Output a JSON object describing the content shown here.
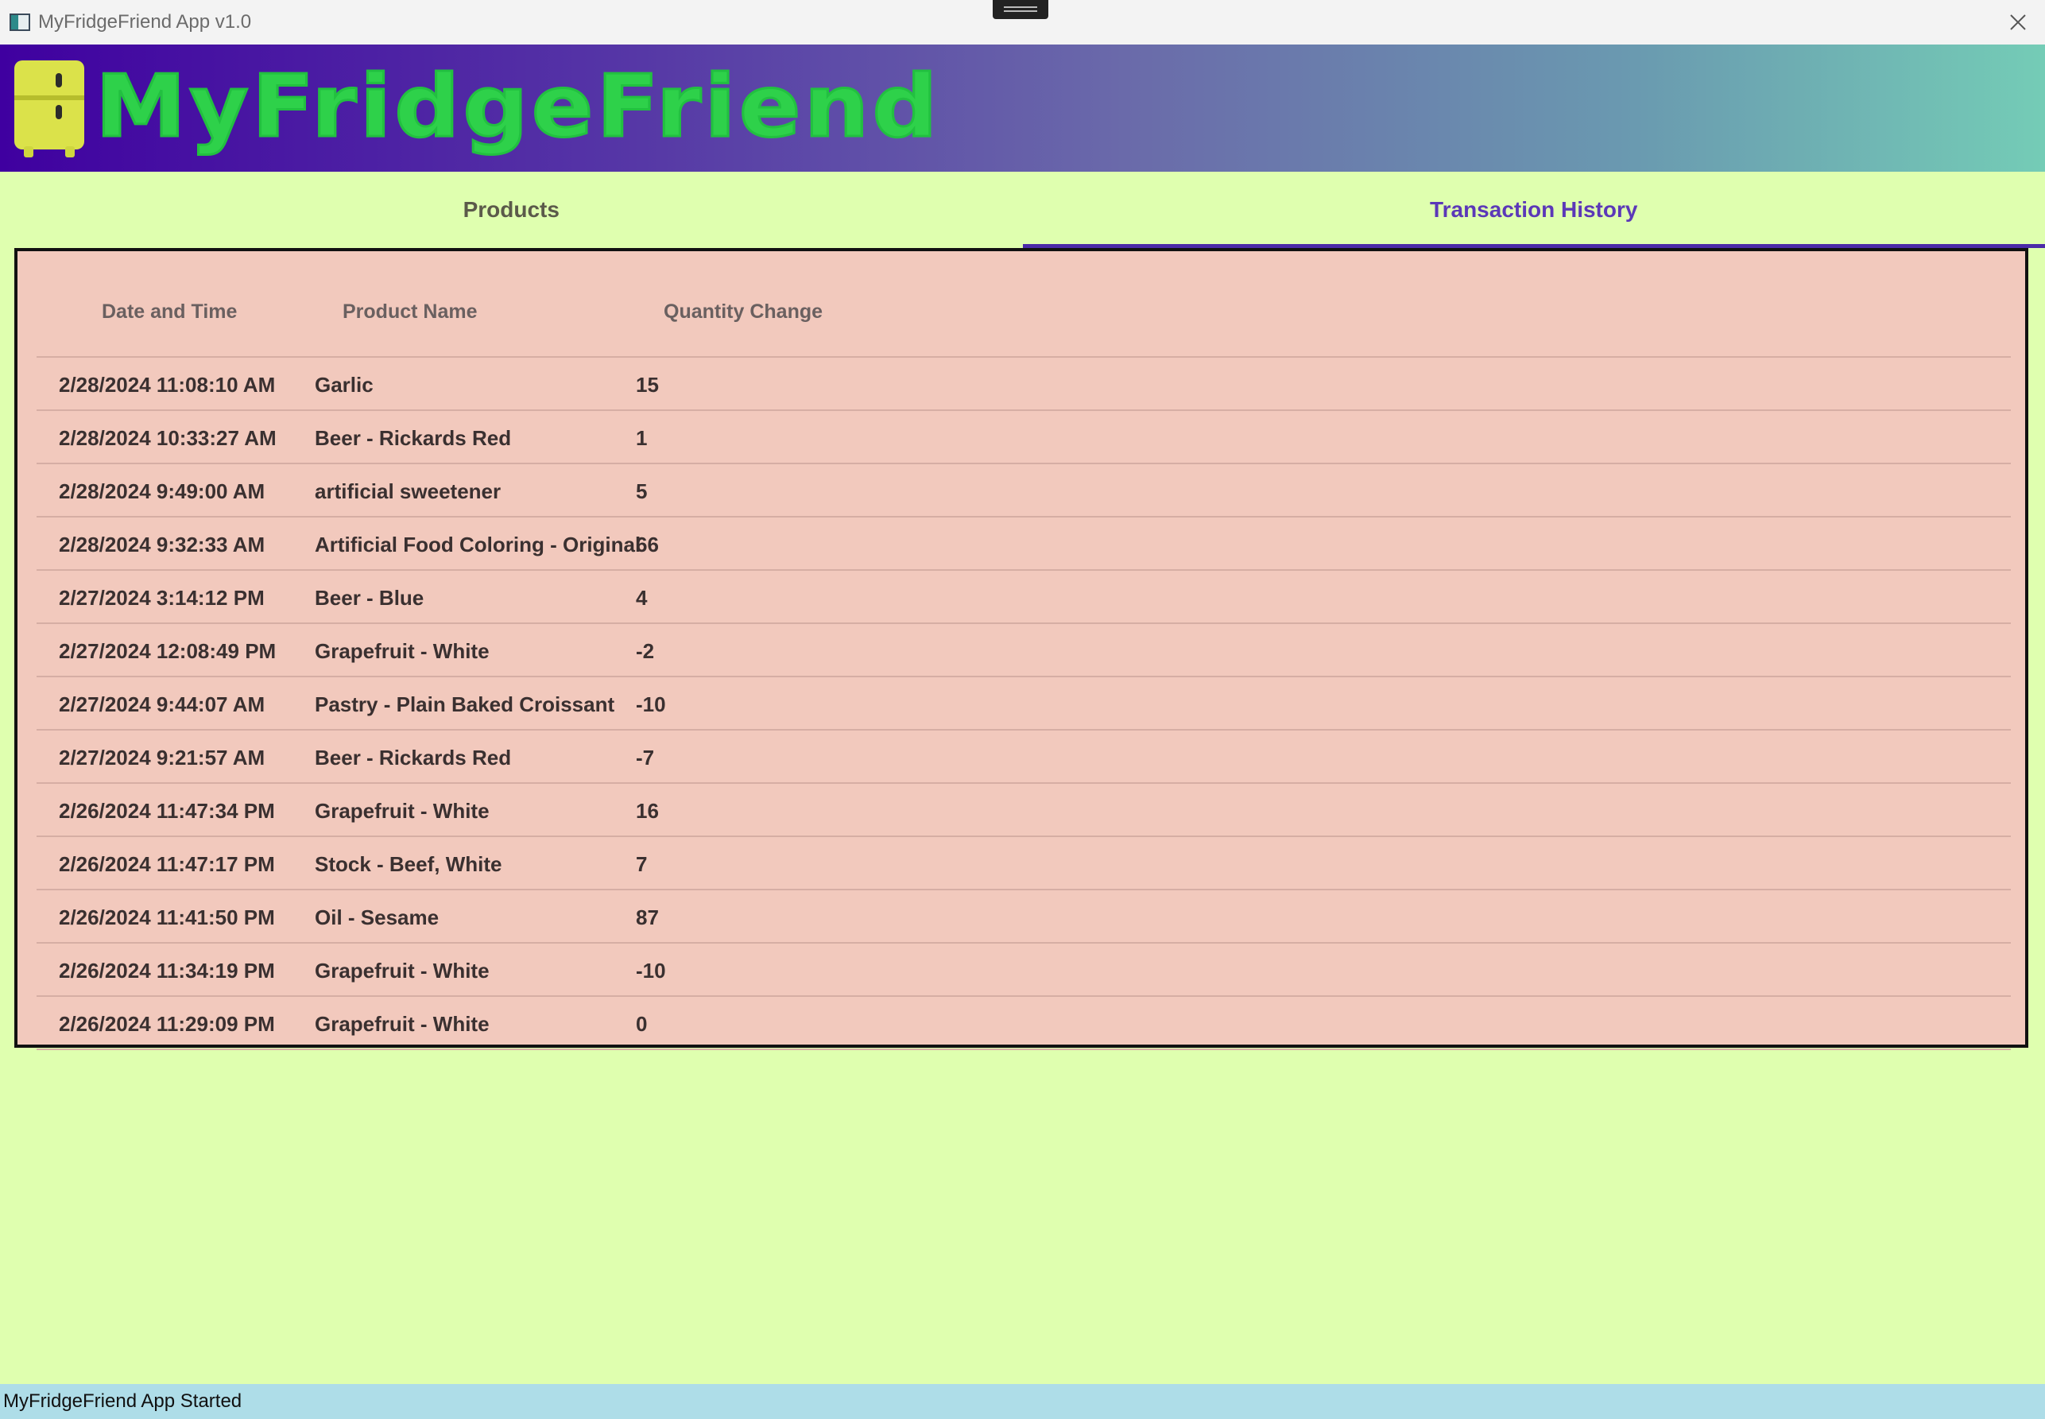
{
  "window": {
    "title": "MyFridgeFriend App v1.0"
  },
  "banner": {
    "brand": "MyFridgeFriend",
    "logo_icon": "fridge-icon"
  },
  "tabs": [
    {
      "label": "Products",
      "active": false
    },
    {
      "label": "Transaction History",
      "active": true
    }
  ],
  "table": {
    "headers": {
      "date": "Date and Time",
      "product": "Product Name",
      "qty": "Quantity Change"
    },
    "rows": [
      {
        "date": "2/28/2024 11:08:10 AM",
        "product": "Garlic",
        "qty": "15"
      },
      {
        "date": "2/28/2024 10:33:27 AM",
        "product": "Beer - Rickards Red",
        "qty": "1"
      },
      {
        "date": "2/28/2024 9:49:00 AM",
        "product": "artificial sweetener",
        "qty": "5"
      },
      {
        "date": "2/28/2024 9:32:33 AM",
        "product": "Artificial Food Coloring - Original",
        "qty": "66"
      },
      {
        "date": "2/27/2024 3:14:12 PM",
        "product": "Beer - Blue",
        "qty": "4"
      },
      {
        "date": "2/27/2024 12:08:49 PM",
        "product": "Grapefruit - White",
        "qty": "-2"
      },
      {
        "date": "2/27/2024 9:44:07 AM",
        "product": "Pastry - Plain Baked Croissant",
        "qty": "-10"
      },
      {
        "date": "2/27/2024 9:21:57 AM",
        "product": "Beer - Rickards Red",
        "qty": "-7"
      },
      {
        "date": "2/26/2024 11:47:34 PM",
        "product": "Grapefruit - White",
        "qty": "16"
      },
      {
        "date": "2/26/2024 11:47:17 PM",
        "product": "Stock - Beef, White",
        "qty": "7"
      },
      {
        "date": "2/26/2024 11:41:50 PM",
        "product": "Oil - Sesame",
        "qty": "87"
      },
      {
        "date": "2/26/2024 11:34:19 PM",
        "product": "Grapefruit - White",
        "qty": "-10"
      },
      {
        "date": "2/26/2024 11:29:09 PM",
        "product": "Grapefruit - White",
        "qty": "0"
      }
    ]
  },
  "status": {
    "text": "MyFridgeFriend App Started"
  },
  "colors": {
    "background": "#dfffaf",
    "table_background": "#f2c9bd",
    "accent": "#4b2aa8",
    "brand_text": "#2ed14a",
    "status_bar": "#aedde8"
  }
}
